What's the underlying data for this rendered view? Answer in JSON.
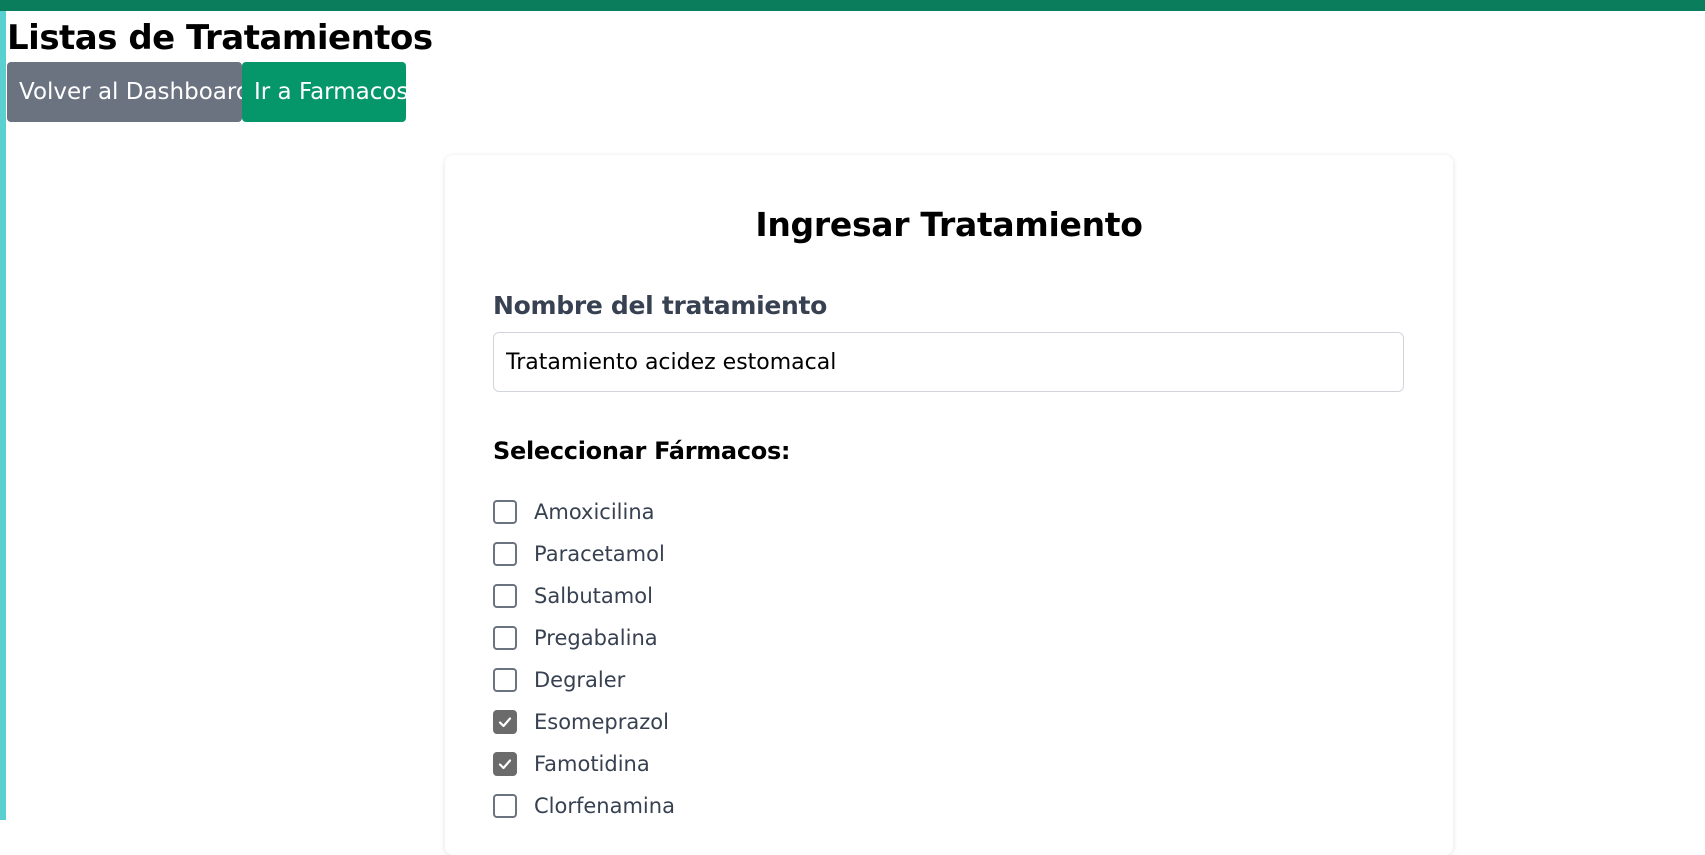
{
  "header": {
    "title": "Listas de Tratamientos",
    "back_button": "Volver al Dashboard",
    "farmacos_button": "Ir a Farmacos"
  },
  "colors": {
    "top_bar": "#0a7e5c",
    "secondary_button": "#6b7280",
    "primary_button": "#059669",
    "left_strip": "#5ad0d0"
  },
  "form": {
    "title": "Ingresar Tratamiento",
    "name_label": "Nombre del tratamiento",
    "name_value": "Tratamiento acidez estomacal",
    "farmacos_label": "Seleccionar Fármacos:",
    "farmacos": [
      {
        "label": "Amoxicilina",
        "checked": false
      },
      {
        "label": "Paracetamol",
        "checked": false
      },
      {
        "label": "Salbutamol",
        "checked": false
      },
      {
        "label": "Pregabalina",
        "checked": false
      },
      {
        "label": "Degraler",
        "checked": false
      },
      {
        "label": "Esomeprazol",
        "checked": true
      },
      {
        "label": "Famotidina",
        "checked": true
      },
      {
        "label": "Clorfenamina",
        "checked": false
      }
    ]
  }
}
